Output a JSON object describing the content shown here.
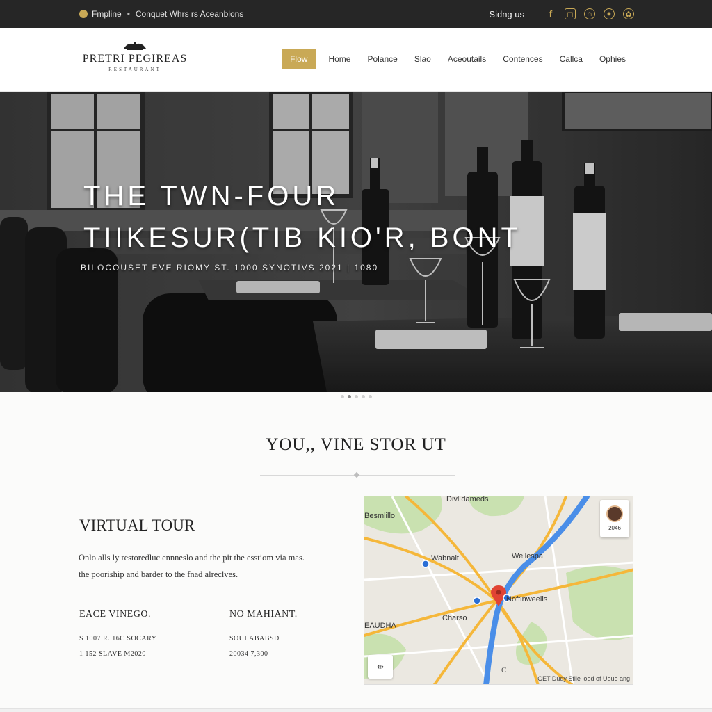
{
  "topbar": {
    "left_text_1": "Fmpline",
    "left_text_2": "Conquet Whrs rs Aceanblons",
    "signin": "Sidng us",
    "social": [
      "facebook-icon",
      "instagram-icon",
      "tripadvisor-icon",
      "opentable-icon",
      "yelp-icon"
    ]
  },
  "logo": {
    "name": "PRETRI PEGIREAS",
    "sub": "RESTAURANT"
  },
  "nav": {
    "items": [
      "Flow",
      "Home",
      "Polance",
      "Slao",
      "Aceoutails",
      "Contences",
      "Callca",
      "Ophies"
    ]
  },
  "hero": {
    "title_line1": "THE TWN-FOUR",
    "title_line2": "TIIKESUR(TIB KIO'R, BONT",
    "subtitle": "BILOCOUSET EVE RIOMY ST. 1000   SYNOTIVS 2021 | 1080"
  },
  "section": {
    "title": "YOU,, VINE STOR UT"
  },
  "virtual_tour": {
    "title": "VIRTUAL TOUR",
    "body_1": "Onlo alls ly restoredluc ennneslo and the pit the esstiom via mas.",
    "body_2": "the pooriship and barder to the fnad alreclves."
  },
  "columns": [
    {
      "head": "EACE VINEGO.",
      "line1": "S 1007 R. 16C SOCARY",
      "line2": "1 152 SLAVE M2020"
    },
    {
      "head": "NO MAHIANT.",
      "line1": "SOULABABSD",
      "line2": "20034 7,300"
    }
  ],
  "map": {
    "labels": [
      "Divl dameds",
      "Besmlillo",
      "Wabnalt",
      "Wellespa",
      "Noftinweelis",
      "Charso",
      "EAUDHA"
    ],
    "card_label": "2046",
    "attribution": "GET Dudy Sfile lood of Uoue ang",
    "zoom_label": "C"
  }
}
